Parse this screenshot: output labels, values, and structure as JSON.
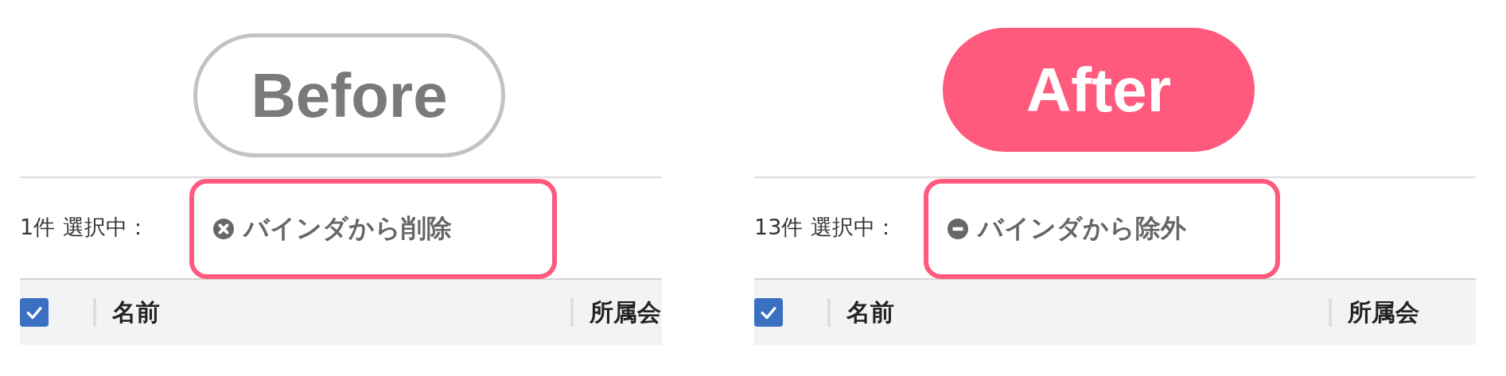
{
  "panels": [
    {
      "kind": "before",
      "badge": "Before",
      "count": "1件",
      "selected_label": "選択中：",
      "action": "バインダから削除",
      "header_checked": true,
      "columns": [
        "名前",
        "所属会"
      ]
    },
    {
      "kind": "after",
      "badge": "After",
      "count": "13件",
      "selected_label": "選択中：",
      "action": "バインダから除外",
      "header_checked": true,
      "columns": [
        "名前",
        "所属会"
      ]
    }
  ]
}
